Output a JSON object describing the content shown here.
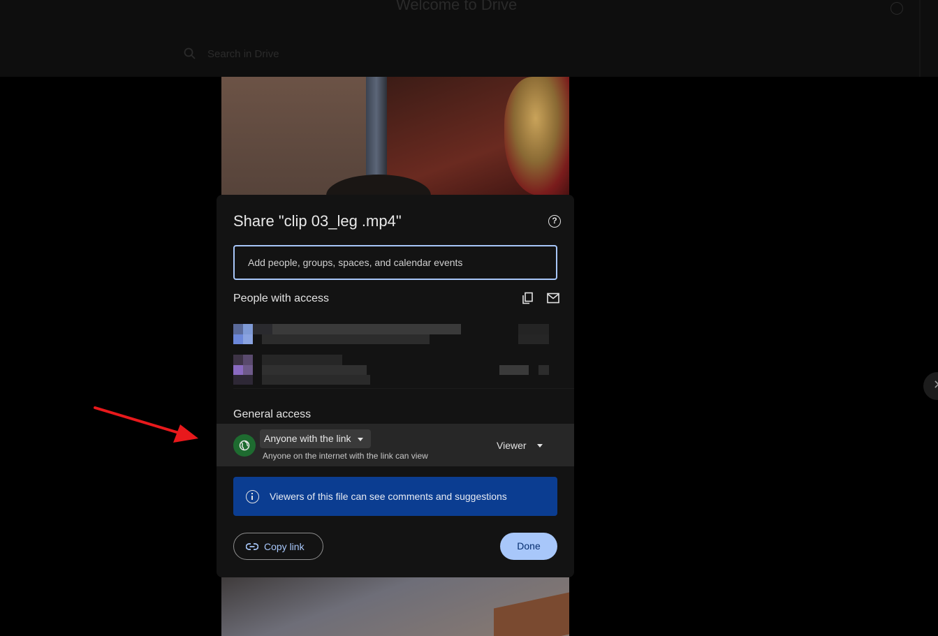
{
  "background": {
    "title": "Welcome to Drive",
    "search_placeholder": "Search in Drive"
  },
  "dialog": {
    "title": "Share \"clip 03_leg .mp4\"",
    "help_icon": "help-circle-icon",
    "add_people_placeholder": "Add people, groups, spaces, and calendar events",
    "people_with_access_label": "People with access",
    "copy_emails_icon": "copy-icon",
    "email_icon": "mail-icon",
    "general_access_label": "General access",
    "access_option": "Anyone with the link",
    "access_description": "Anyone on the internet with the link can view",
    "role": "Viewer",
    "info_banner": "Viewers of this file can see comments and suggestions",
    "copy_link_label": "Copy link",
    "done_label": "Done"
  },
  "colors": {
    "accent": "#a8c7fa",
    "banner": "#0b3d91",
    "globe": "#1e6b30",
    "annotation_arrow": "#e8191c"
  }
}
